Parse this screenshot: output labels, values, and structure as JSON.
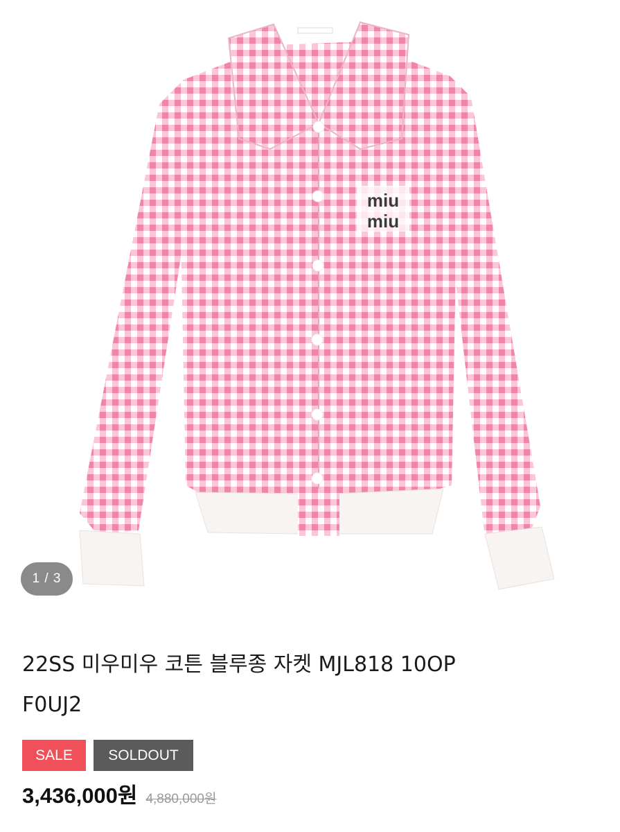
{
  "gallery": {
    "counter": "1 / 3",
    "logo_text": "miu"
  },
  "product": {
    "title_line1": "22SS 미우미우 코튼 블루종 자켓 MJL818 10OP",
    "title_line2": "F0UJ2",
    "badges": {
      "sale": "SALE",
      "soldout": "SOLDOUT"
    },
    "price": "3,436,000원",
    "original_price": "4,880,000원"
  },
  "colors": {
    "sale_badge": "#f0505a",
    "soldout_badge": "#5b5b5b",
    "gingham_pink": "#f29bb8",
    "counter_bg": "#8a8a8a"
  }
}
